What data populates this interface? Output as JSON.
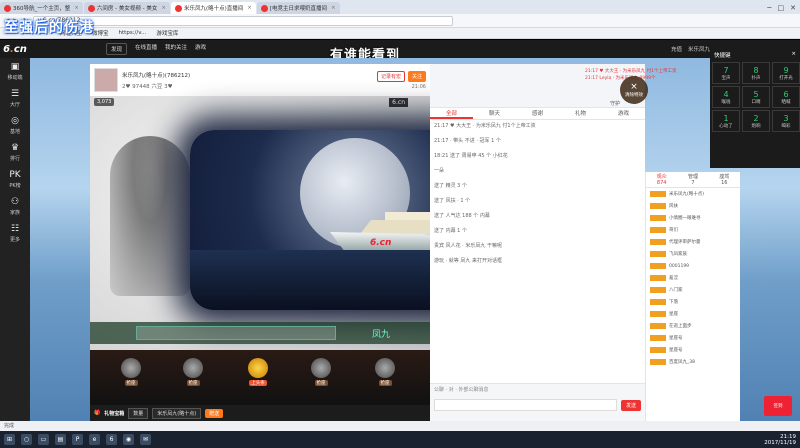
{
  "browser": {
    "tabs": [
      {
        "label": "360导航_一个主页，整"
      },
      {
        "label": "六间房 - 美女视频 - 美女"
      },
      {
        "label": "米乐凤九(略十点)直播间"
      },
      {
        "label": "[电竞主日求喂奶直播间"
      }
    ],
    "url": "v.6.cn/786212",
    "bookmarks": [
      "网址大全",
      "微博宝",
      "https://v...",
      "游戏宝库"
    ]
  },
  "overlay_title": "至强后的伤港",
  "site": {
    "nav": [
      "发现",
      "在线直播",
      "我的关注",
      "游戏"
    ],
    "right": [
      "充值",
      "米乐凤九"
    ],
    "banner_text": "有谁能看到"
  },
  "leftnav": [
    {
      "icon": "▣",
      "label": "移动端"
    },
    {
      "icon": "☰",
      "label": "大厅"
    },
    {
      "icon": "◎",
      "label": "基地"
    },
    {
      "icon": "♛",
      "label": "排行"
    },
    {
      "icon": "PK",
      "label": "PK榜"
    },
    {
      "icon": "⚇",
      "label": "家族"
    },
    {
      "icon": "☷",
      "label": "更多"
    }
  ],
  "anchor": {
    "name": "米乐凤九(略十点)",
    "id": "(786212)",
    "stats": "2♥  97448 六豆  3♥",
    "btn_record": "记录有宏",
    "btn_follow": "关注",
    "time": "21:06"
  },
  "video": {
    "viewers": "3,073",
    "logo": "6.cn"
  },
  "moon_brand": "6.cn",
  "seats": [
    {
      "label": "抢座"
    },
    {
      "label": "抢座"
    },
    {
      "label": "上头条"
    },
    {
      "label": "抢座"
    },
    {
      "label": "抢座"
    }
  ],
  "lobby_ft": "凤九",
  "giftbar": {
    "label": "礼物宝箱",
    "sel1": "数量",
    "sel2": "米乐凤九(略十点)",
    "send": "赠送"
  },
  "chat": {
    "tabs": [
      "全部",
      "聊天",
      "感谢",
      "礼物",
      "游戏"
    ],
    "messages": [
      "21:17 ♥ 大大王 · 为米乐凤九 付1个上帝工资",
      "21:17 · 带头 不进 · 冠军 1 个",
      "18:21 送了 周易申 45 个 小红花",
      "一朵",
      "送了 精灵 3 个",
      "送了 风扶 · 1 个",
      "送了 人气达 188 个 内幕",
      "送了 内幕 1 个",
      "贵宾 风人花 · 米乐凤九 干嘛呢",
      "游玩 · 就等 凤九 来打开对话框"
    ],
    "input_hint": "公聊 · 对 · 外部公聊消息",
    "send": "发送",
    "tab_extra": "守护"
  },
  "info": {
    "lines": [
      "21:17 ♥ 大大王 · 为米乐凤九 付1个上帝工资",
      "21:17 Leyla · 为米乐凤九 9999个"
    ],
    "close_label": "清除特效"
  },
  "audience": {
    "tabs": [
      {
        "title": "观众",
        "count": "874"
      },
      {
        "title": "管理",
        "count": "7"
      },
      {
        "title": "座驾",
        "count": "16"
      }
    ],
    "rows": [
      "米乐凤九(略十点)",
      "风扶",
      "小情圈一眼难寻",
      "哥们",
      "代理评审萨尔曼",
      "飞凤家族",
      "0001199",
      "羞涩",
      "八门家",
      "下落",
      "星座",
      "在逝上面步",
      "星座号",
      "星座号",
      "百度凤九_38"
    ]
  },
  "shortcut": {
    "title": "快捷键",
    "keys": [
      {
        "k": "7",
        "label": "宝声"
      },
      {
        "k": "8",
        "label": "扑声"
      },
      {
        "k": "9",
        "label": "打开光"
      },
      {
        "k": "4",
        "label": "喉咙"
      },
      {
        "k": "5",
        "label": "口哨"
      },
      {
        "k": "6",
        "label": "晒喊"
      },
      {
        "k": "1",
        "label": "心动了"
      },
      {
        "k": "2",
        "label": "炮响"
      },
      {
        "k": "3",
        "label": "喝彩"
      }
    ]
  },
  "status_text": "完成",
  "red_badge": "签到",
  "clock": {
    "time": "21:19",
    "date": "2017/11/19"
  }
}
